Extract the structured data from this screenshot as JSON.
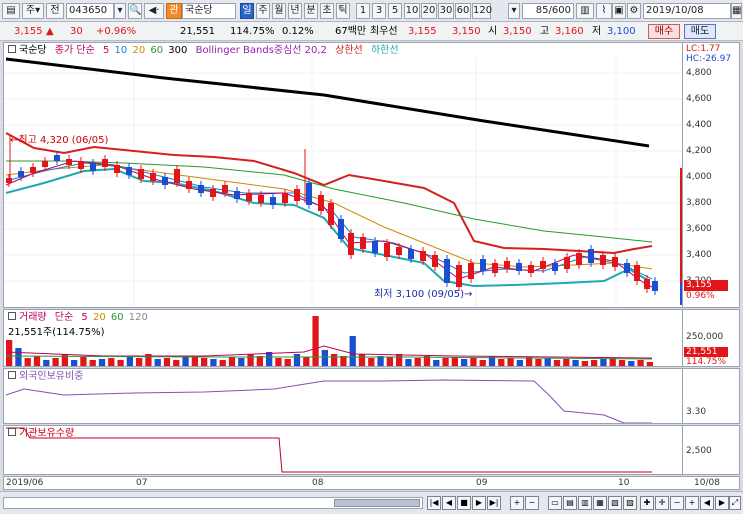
{
  "toolbar": {
    "period_unit": "주",
    "market_label": "전",
    "code_value": "043650",
    "chip_label": "관",
    "stock_name_value": "국순당",
    "period_buttons": [
      "일",
      "주",
      "월",
      "년",
      "분",
      "초",
      "틱"
    ],
    "interval_buttons": [
      "1",
      "3",
      "5",
      "10",
      "20",
      "30",
      "60",
      "120"
    ],
    "count_value": "85",
    "count_total": "/600",
    "date_value": "2019/10/08"
  },
  "info": {
    "price": "3,155",
    "change_arrow": "▲",
    "change": "30",
    "change_pct": "+0.96%",
    "volume": "21,551",
    "volume_ratio": "114.75%",
    "turnover": "0.12%",
    "amount": "67백만",
    "best_ask_label": "최우선",
    "best_ask": "3,155",
    "best_bid": "3,150",
    "open_label": "시",
    "open": "3,150",
    "high_label": "고",
    "high": "3,160",
    "low_label": "저",
    "low": "3,100",
    "buy_label": "매수",
    "sell_label": "매도"
  },
  "price_pane": {
    "legend": {
      "name": "국순당",
      "ma_label": "종가 단순",
      "ma_periods": [
        "5",
        "10",
        "20",
        "60",
        "300"
      ],
      "ma_colors": [
        "#c00060",
        "#1a7fd0",
        "#d08a00",
        "#2a9a2a",
        "#000000"
      ],
      "bb_label": "Bollinger Bands중심선 20,2",
      "upper_label": "상한선",
      "lower_label": "하한선"
    },
    "lc": "LC:1.77",
    "hc": "HC:-26.97",
    "y_ticks": [
      "4,800",
      "4,600",
      "4,400",
      "4,200",
      "4,000",
      "3,800",
      "3,600",
      "3,400",
      "3,200"
    ],
    "high_annotation": "최고 4,320 (06/05)",
    "low_annotation": "최저 3,100 (09/05)",
    "last_price_tag": "3,155",
    "last_pct_tag": "0.96%"
  },
  "volume_pane": {
    "legend": {
      "name": "거래량",
      "ma_label": "단순",
      "periods": [
        "5",
        "20",
        "60",
        "120"
      ],
      "colors": [
        "#c00060",
        "#d08a00",
        "#2a9a2a",
        "#888888"
      ]
    },
    "volume_text": "21,551주(114.75%)",
    "y_tick": "250,000",
    "last_vol_tag": "21,551",
    "last_ratio_tag": "114.75%"
  },
  "foreign_pane": {
    "title": "외국인보유비중",
    "y_tick": "3.30"
  },
  "inst_pane": {
    "title": "기관보유수량",
    "y_tick": "2,500"
  },
  "x_axis": {
    "labels": [
      "2019/06",
      "07",
      "08",
      "09",
      "10",
      "10/08"
    ]
  },
  "colors": {
    "up": "#e0161b",
    "down": "#1a4fd0",
    "upper_band": "#d42020",
    "lower_band": "#20a8b0",
    "ma60": "#2a9a2a",
    "ma300": "#000000"
  }
}
